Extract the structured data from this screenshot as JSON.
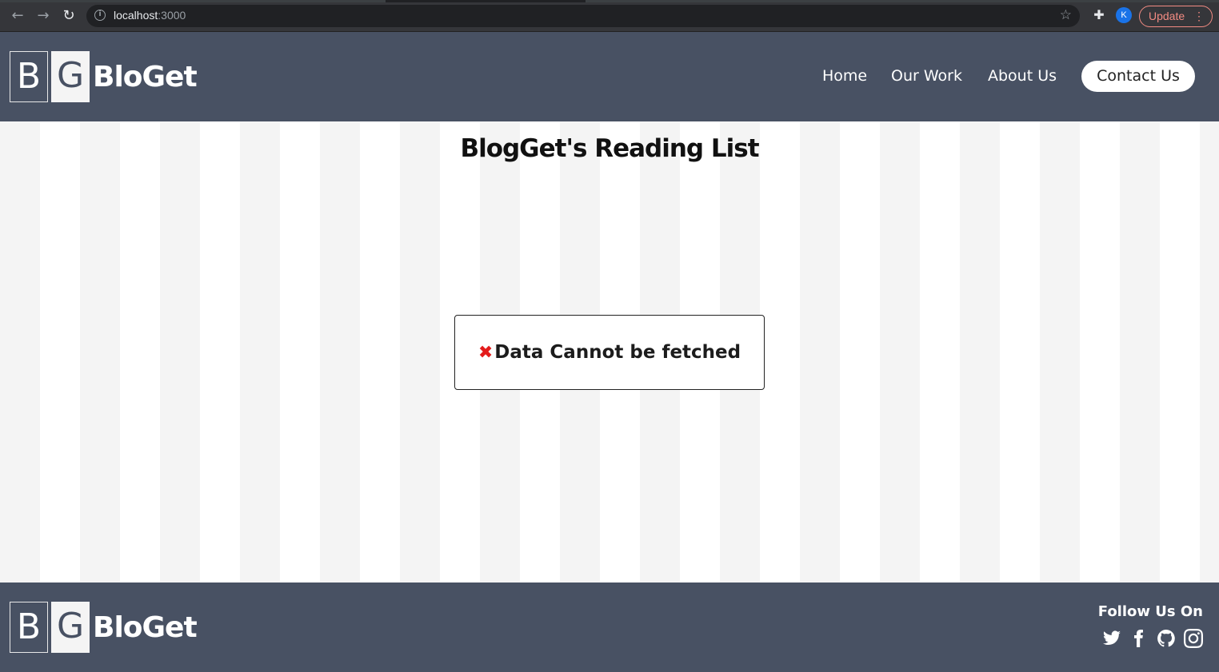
{
  "browser": {
    "url_host": "localhost",
    "url_port": ":3000",
    "profile_initial": "K",
    "update_label": "Update"
  },
  "header": {
    "logo_b": "B",
    "logo_g": "G",
    "logo_name": "BloGet",
    "nav": [
      {
        "label": "Home"
      },
      {
        "label": "Our Work"
      },
      {
        "label": "About Us"
      }
    ],
    "contact_label": "Contact Us"
  },
  "main": {
    "title": "BlogGet's Reading List",
    "error_icon": "✖",
    "error_message": "Data Cannot be fetched"
  },
  "footer": {
    "logo_b": "B",
    "logo_g": "G",
    "logo_name": "BloGet",
    "follow_label": "Follow Us On",
    "socials": [
      "twitter-icon",
      "facebook-icon",
      "github-icon",
      "instagram-icon"
    ]
  }
}
